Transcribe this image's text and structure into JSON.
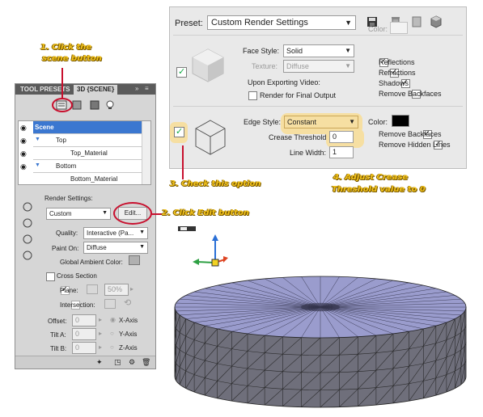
{
  "dialog": {
    "preset_label": "Preset:",
    "preset_value": "Custom Render Settings",
    "face_style_label": "Face Style:",
    "face_style_value": "Solid",
    "texture_label": "Texture:",
    "texture_value": "Diffuse",
    "upon_exporting": "Upon Exporting Video:",
    "render_final": "Render for Final Output",
    "color_label_1": "Color:",
    "reflections": "Reflections",
    "refractions": "Refractions",
    "shadows": "Shadows",
    "remove_backfaces_1": "Remove Backfaces",
    "edge_style_label": "Edge Style:",
    "edge_style_value": "Constant",
    "crease_threshold_label": "Crease Threshold:",
    "crease_threshold_value": "0",
    "line_width_label": "Line Width:",
    "line_width_value": "1",
    "color_label_2": "Color:",
    "remove_backfaces_2": "Remove Backfaces",
    "remove_hidden_lines": "Remove Hidden Lines"
  },
  "panel": {
    "tab_1": "TOOL PRESETS",
    "tab_2": "3D {SCENE}",
    "tree": [
      {
        "label": "Scene"
      },
      {
        "label": "Top"
      },
      {
        "label": "Top_Material"
      },
      {
        "label": "Bottom"
      },
      {
        "label": "Bottom_Material"
      }
    ],
    "render_settings_label": "Render Settings:",
    "render_settings_value": "Custom",
    "edit_button": "Edit...",
    "quality_label": "Quality:",
    "quality_value": "Interactive (Pa...",
    "paint_on_label": "Paint On:",
    "paint_on_value": "Diffuse",
    "global_ambient": "Global Ambient Color:",
    "cross_section": "Cross Section",
    "plane": "Plane:",
    "plane_value": "50%",
    "intersection": "Intersection:",
    "offset": "Offset:",
    "offset_value": "0",
    "tilt_a": "Tilt A:",
    "tilt_a_value": "0",
    "tilt_b": "Tilt B:",
    "tilt_b_value": "0",
    "x_axis": "X-Axis",
    "y_axis": "Y-Axis",
    "z_axis": "Z-Axis"
  },
  "callouts": {
    "c1_line1": "1. Click the",
    "c1_line2": "scene button",
    "c2": "2. Click Edit button",
    "c3": "3. Check this option",
    "c4_line1": "4. Adjust Crease",
    "c4_line2": "Threshold value to 0"
  },
  "colors": {
    "highlight": "#f6dfa2",
    "accent_red": "#c8102e",
    "callout_yellow": "#f2c21b",
    "cylinder_top": "#9a9ccd",
    "cylinder_side": "#6f6f7b"
  }
}
